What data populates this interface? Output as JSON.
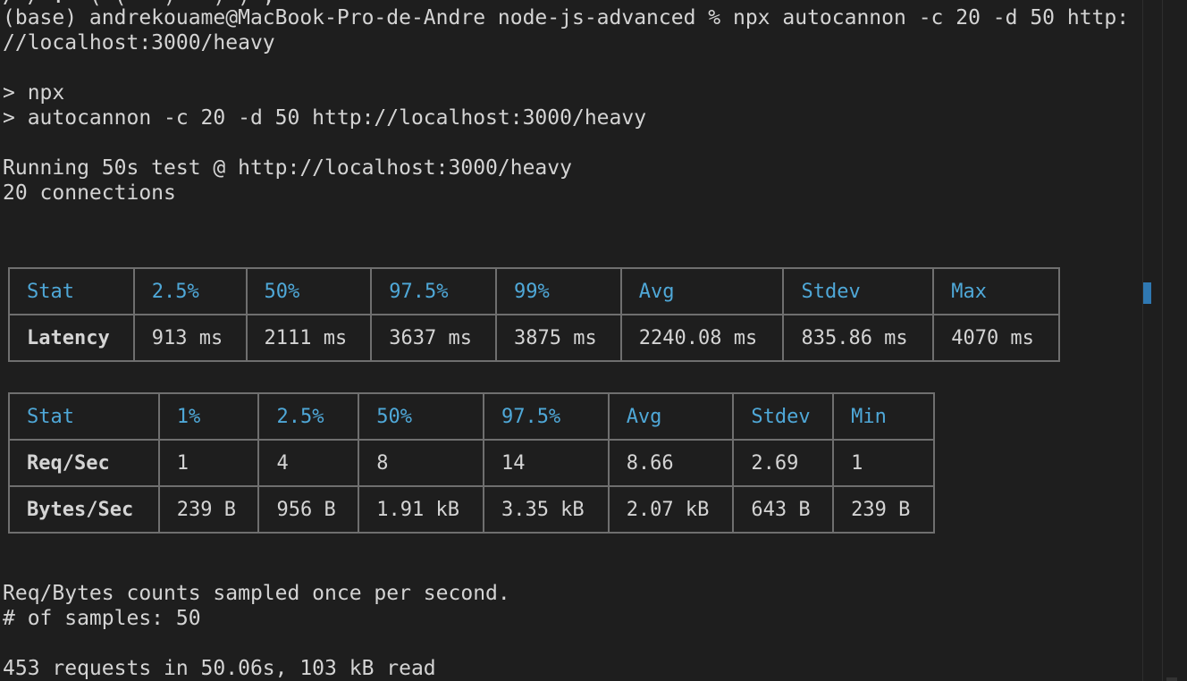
{
  "terminal": {
    "cut_top_line": "/ / .  ( (   )   ) ) ;",
    "lines": [
      "(base) andrekouame@MacBook-Pro-de-Andre node-js-advanced % npx autocannon -c 20 -d 50 http:",
      "//localhost:3000/heavy",
      "",
      "> npx",
      "> autocannon -c 20 -d 50 http://localhost:3000/heavy",
      "",
      "Running 50s test @ http://localhost:3000/heavy",
      "20 connections"
    ],
    "footer_lines": [
      "Req/Bytes counts sampled once per second.",
      "# of samples: 50",
      "",
      "453 requests in 50.06s, 103 kB read"
    ]
  },
  "latency_table": {
    "headers": [
      "Stat",
      "2.5%",
      "50%",
      "97.5%",
      "99%",
      "Avg",
      "Stdev",
      "Max"
    ],
    "rows": [
      [
        "Latency",
        "913 ms",
        "2111 ms",
        "3637 ms",
        "3875 ms",
        "2240.08 ms",
        "835.86 ms",
        "4070 ms"
      ]
    ]
  },
  "throughput_table": {
    "headers": [
      "Stat",
      "1%",
      "2.5%",
      "50%",
      "97.5%",
      "Avg",
      "Stdev",
      "Min"
    ],
    "rows": [
      [
        "Req/Sec",
        "1",
        "4",
        "8",
        "14",
        "8.66",
        "2.69",
        "1"
      ],
      [
        "Bytes/Sec",
        "239 B",
        "956 B",
        "1.91 kB",
        "3.35 kB",
        "2.07 kB",
        "643 B",
        "239 B"
      ]
    ]
  },
  "colors": {
    "background": "#1e1e1e",
    "text": "#d4d4d4",
    "header_text": "#4fa8d8",
    "table_border": "#6f6f6f",
    "scroll_marker": "#2f78b2"
  }
}
